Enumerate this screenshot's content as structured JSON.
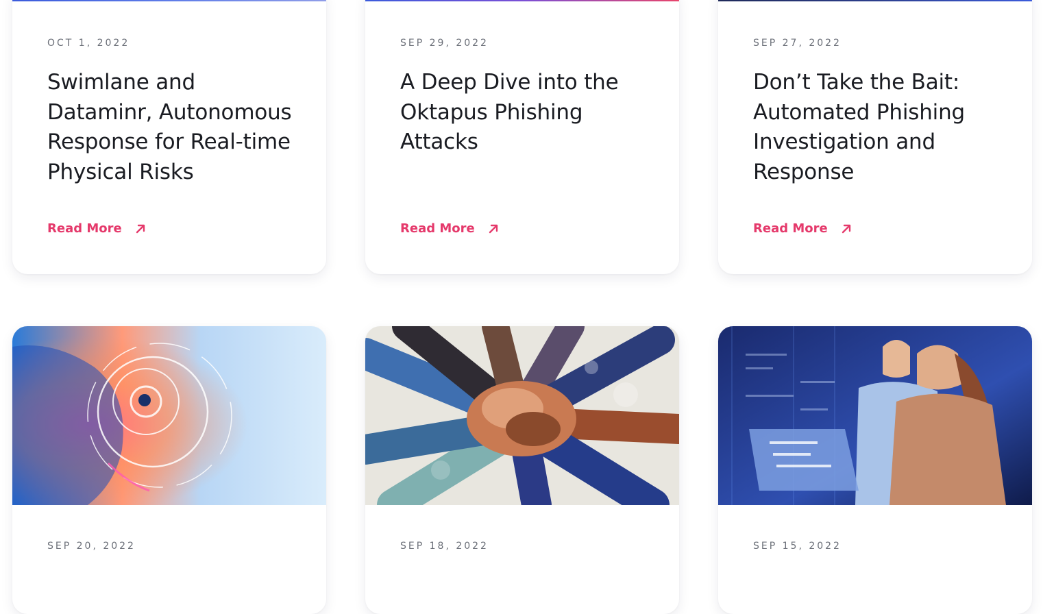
{
  "posts": [
    {
      "date": "OCT 1, 2022",
      "title": "Swimlane and Dataminr, Autonomous Response for Real-time Physical Risks",
      "cta": "Read More"
    },
    {
      "date": "SEP 29, 2022",
      "title": "A Deep Dive into the Oktapus Phishing Attacks",
      "cta": "Read More"
    },
    {
      "date": "SEP 27, 2022",
      "title": "Don’t Take the Bait: Automated Phishing Investigation and Response",
      "cta": "Read More"
    },
    {
      "date": "SEP 20, 2022",
      "image_icon": "futuristic-eye-hud-image"
    },
    {
      "date": "SEP 18, 2022",
      "image_icon": "team-hands-together-image"
    },
    {
      "date": "SEP 15, 2022",
      "image_icon": "engineers-with-laptop-server-room-image"
    }
  ],
  "colors": {
    "accent": "#e5396b",
    "title": "#1a1c22",
    "date": "#6b6f78"
  }
}
